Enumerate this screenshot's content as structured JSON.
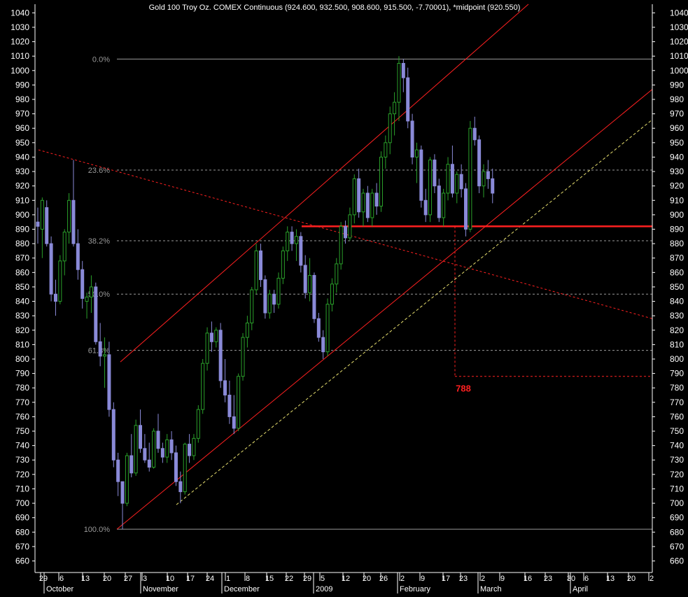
{
  "title": "Gold 100 Troy Oz. COMEX Continuous (924.600, 932.500, 908.600, 915.500, -7.70001), *midpoint (920.550)",
  "chart_data": {
    "type": "candlestick",
    "title": "Gold 100 Troy Oz. COMEX Continuous (924.600, 932.500, 908.600, 915.500, -7.70001), *midpoint (920.550)",
    "ylim": [
      652,
      1046
    ],
    "y_ticks": [
      660,
      670,
      680,
      690,
      700,
      710,
      720,
      730,
      740,
      750,
      760,
      770,
      780,
      790,
      800,
      810,
      820,
      830,
      840,
      850,
      860,
      870,
      880,
      890,
      900,
      910,
      920,
      930,
      940,
      950,
      960,
      970,
      980,
      990,
      1000,
      1010,
      1020,
      1030,
      1040
    ],
    "x_day_ticks": [
      "29",
      "6",
      "13",
      "20",
      "27",
      "3",
      "10",
      "17",
      "24",
      "1",
      "8",
      "15",
      "22",
      "29",
      "5",
      "12",
      "20",
      "26",
      "2",
      "9",
      "17",
      "23",
      "2",
      "9",
      "16",
      "23",
      "30",
      "6",
      "13",
      "20",
      "2"
    ],
    "x_month_labels": [
      "October",
      "November",
      "December",
      "2009",
      "February",
      "March",
      "April"
    ],
    "bar_count": 131,
    "series": [
      {
        "ohlc": [
          [
            895,
            905,
            880,
            892
          ],
          [
            890,
            912,
            870,
            910
          ],
          [
            905,
            910,
            878,
            880
          ],
          [
            880,
            885,
            840,
            845
          ],
          [
            845,
            855,
            830,
            840
          ],
          [
            840,
            872,
            838,
            868
          ],
          [
            868,
            890,
            858,
            888
          ],
          [
            888,
            915,
            880,
            910
          ],
          [
            910,
            938,
            878,
            880
          ],
          [
            880,
            890,
            855,
            862
          ],
          [
            862,
            868,
            835,
            842
          ],
          [
            840,
            846,
            828,
            843
          ],
          [
            843,
            858,
            832,
            850
          ],
          [
            850,
            853,
            810,
            812
          ],
          [
            812,
            825,
            795,
            802
          ],
          [
            802,
            815,
            780,
            803
          ],
          [
            803,
            812,
            760,
            765
          ],
          [
            765,
            770,
            725,
            730
          ],
          [
            730,
            735,
            705,
            715
          ],
          [
            715,
            700,
            682,
            700
          ],
          [
            700,
            735,
            698,
            733
          ],
          [
            733,
            748,
            718,
            721
          ],
          [
            721,
            758,
            719,
            754
          ],
          [
            754,
            765,
            735,
            738
          ],
          [
            738,
            748,
            728,
            730
          ],
          [
            730,
            742,
            722,
            725
          ],
          [
            725,
            752,
            724,
            750
          ],
          [
            750,
            762,
            735,
            738
          ],
          [
            738,
            742,
            728,
            732
          ],
          [
            732,
            748,
            728,
            744
          ],
          [
            744,
            750,
            730,
            735
          ],
          [
            735,
            740,
            712,
            715
          ],
          [
            715,
            722,
            700,
            708
          ],
          [
            708,
            742,
            706,
            741
          ],
          [
            741,
            748,
            728,
            733
          ],
          [
            733,
            748,
            730,
            745
          ],
          [
            745,
            768,
            742,
            765
          ],
          [
            765,
            800,
            762,
            797
          ],
          [
            797,
            822,
            792,
            818
          ],
          [
            818,
            826,
            805,
            812
          ],
          [
            812,
            822,
            808,
            820
          ],
          [
            820,
            825,
            780,
            785
          ],
          [
            785,
            800,
            770,
            775
          ],
          [
            775,
            785,
            755,
            760
          ],
          [
            760,
            775,
            748,
            752
          ],
          [
            752,
            790,
            750,
            788
          ],
          [
            788,
            818,
            785,
            815
          ],
          [
            815,
            830,
            808,
            825
          ],
          [
            825,
            850,
            820,
            848
          ],
          [
            848,
            880,
            845,
            875
          ],
          [
            875,
            880,
            850,
            855
          ],
          [
            855,
            858,
            828,
            832
          ],
          [
            832,
            848,
            828,
            845
          ],
          [
            845,
            848,
            832,
            838
          ],
          [
            838,
            860,
            835,
            856
          ],
          [
            856,
            878,
            852,
            875
          ],
          [
            875,
            892,
            868,
            888
          ],
          [
            888,
            892,
            875,
            880
          ],
          [
            880,
            890,
            868,
            885
          ],
          [
            885,
            888,
            860,
            865
          ],
          [
            865,
            872,
            842,
            846
          ],
          [
            846,
            870,
            840,
            858
          ],
          [
            858,
            860,
            825,
            828
          ],
          [
            828,
            832,
            812,
            815
          ],
          [
            815,
            820,
            800,
            805
          ],
          [
            805,
            842,
            802,
            838
          ],
          [
            838,
            856,
            833,
            852
          ],
          [
            852,
            870,
            846,
            866
          ],
          [
            866,
            895,
            862,
            892
          ],
          [
            892,
            896,
            880,
            884
          ],
          [
            884,
            905,
            882,
            900
          ],
          [
            900,
            928,
            894,
            925
          ],
          [
            925,
            932,
            898,
            902
          ],
          [
            902,
            918,
            892,
            915
          ],
          [
            915,
            920,
            895,
            898
          ],
          [
            898,
            918,
            892,
            915
          ],
          [
            915,
            922,
            900,
            906
          ],
          [
            906,
            944,
            902,
            940
          ],
          [
            940,
            955,
            932,
            950
          ],
          [
            950,
            975,
            942,
            970
          ],
          [
            970,
            985,
            955,
            978
          ],
          [
            978,
            1010,
            965,
            1005
          ],
          [
            1005,
            1008,
            985,
            995
          ],
          [
            995,
            1002,
            960,
            965
          ],
          [
            965,
            970,
            935,
            940
          ],
          [
            940,
            950,
            922,
            945
          ],
          [
            945,
            948,
            905,
            910
          ],
          [
            910,
            918,
            895,
            900
          ],
          [
            900,
            940,
            895,
            938
          ],
          [
            938,
            942,
            915,
            920
          ],
          [
            920,
            925,
            895,
            898
          ],
          [
            898,
            918,
            892,
            915
          ],
          [
            915,
            940,
            910,
            935
          ],
          [
            935,
            948,
            912,
            915
          ],
          [
            915,
            930,
            908,
            928
          ],
          [
            928,
            935,
            912,
            918
          ],
          [
            918,
            922,
            885,
            890
          ],
          [
            890,
            965,
            888,
            960
          ],
          [
            960,
            968,
            948,
            952
          ],
          [
            952,
            955,
            915,
            920
          ],
          [
            920,
            935,
            912,
            930
          ],
          [
            930,
            938,
            918,
            925
          ],
          [
            925,
            932,
            908,
            915
          ]
        ]
      }
    ],
    "annotations": {
      "fib_levels": [
        "0.0%",
        "23.6%",
        "38.2%",
        "50.0%",
        "61.8%",
        "100.0%"
      ],
      "fib_values": [
        1008,
        931,
        882,
        845,
        806,
        682
      ],
      "support_level": 892,
      "target_label": "788",
      "target_value": 788
    },
    "colors": {
      "up": "#2aa02a",
      "down": "#8a8ad8",
      "trend": "#ff2020",
      "text": "#ffffff",
      "fib": "#9a9a9a",
      "target": "#ff2020"
    }
  }
}
